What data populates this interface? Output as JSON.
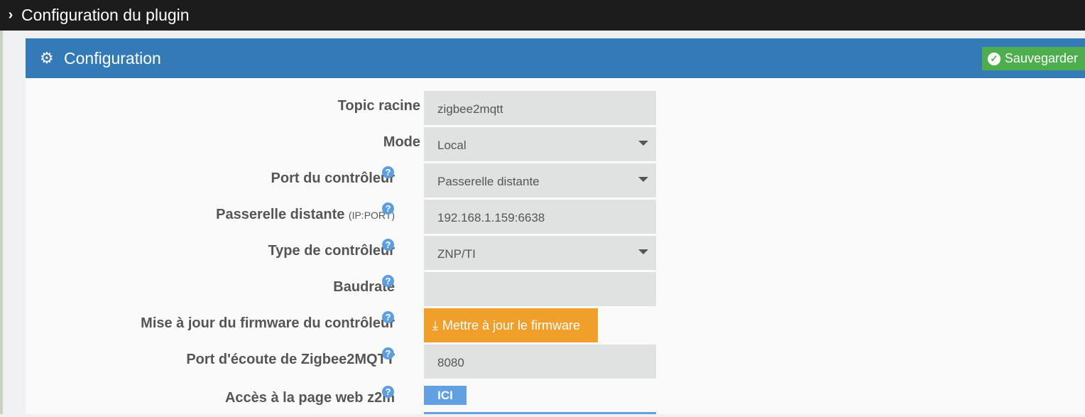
{
  "topbar": {
    "title": "Configuration du plugin"
  },
  "panel": {
    "title": "Configuration",
    "save_label": "Sauvegarder"
  },
  "fields": [
    {
      "label": "Topic racine",
      "value": "zigbee2mqtt"
    },
    {
      "label": "Mode",
      "value": "Local"
    },
    {
      "label": "Port du contrôleur",
      "value": "Passerelle distante"
    },
    {
      "label": "Passerelle distante",
      "sublabel": "(IP:PORT)",
      "value": "192.168.1.159:6638"
    },
    {
      "label": "Type de contrôleur",
      "value": "ZNP/TI"
    },
    {
      "label": "Baudrate",
      "value": ""
    },
    {
      "label": "Mise à jour du firmware du contrôleur",
      "button": "Mettre à jour le firmware"
    },
    {
      "label": "Port d'écoute de Zigbee2MQTT",
      "value": "8080"
    },
    {
      "label": "Accès à la page web z2m",
      "button": "ICI"
    }
  ],
  "help_glyph": "?"
}
